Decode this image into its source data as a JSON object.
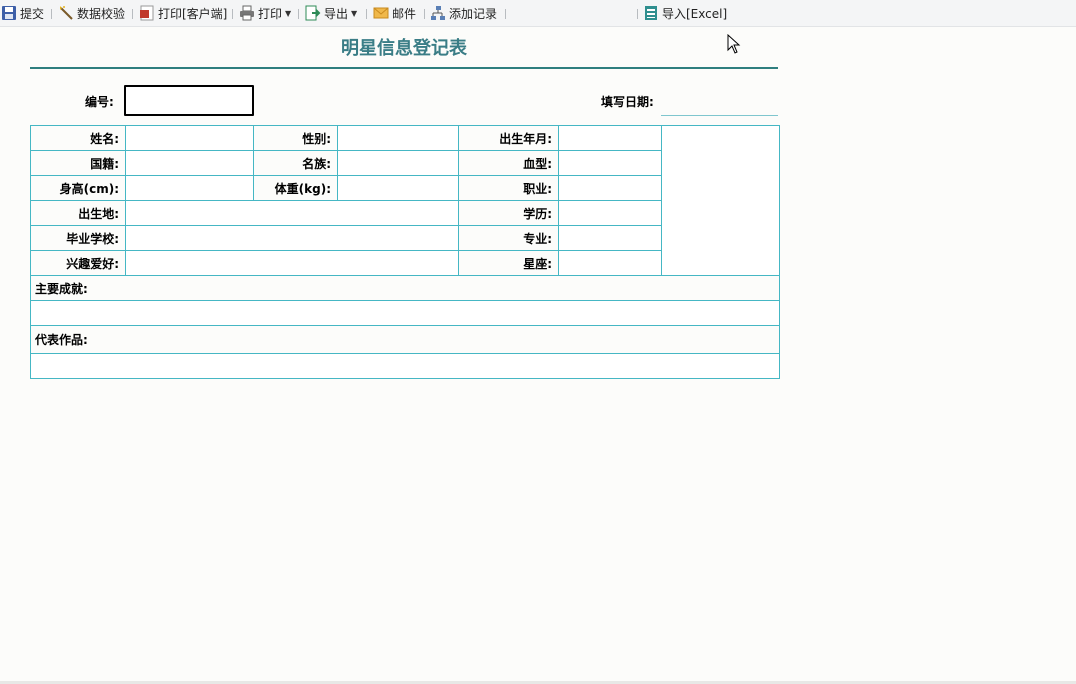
{
  "toolbar": {
    "items": [
      {
        "label": "提交",
        "icon": "save-icon"
      },
      {
        "label": "数据校验",
        "icon": "validate-wand-icon"
      },
      {
        "label": "打印[客户端]",
        "icon": "pdf-print-icon"
      },
      {
        "label": "打印",
        "icon": "printer-icon"
      },
      {
        "label": "导出",
        "icon": "export-icon"
      },
      {
        "label": "邮件",
        "icon": "mail-icon"
      },
      {
        "label": "添加记录",
        "icon": "add-record-icon"
      },
      {
        "label": "导入[Excel]",
        "icon": "excel-import-icon"
      }
    ]
  },
  "form": {
    "title": "明星信息登记表",
    "id_label": "编号:",
    "date_label": "填写日期:",
    "labels": {
      "name": "姓名:",
      "gender": "性别:",
      "birth_month": "出生年月:",
      "nationality": "国籍:",
      "ethnicity": "名族:",
      "blood_type": "血型:",
      "height": "身高(cm):",
      "weight": "体重(kg):",
      "occupation": "职业:",
      "birthplace": "出生地:",
      "education": "学历:",
      "school": "毕业学校:",
      "major": "专业:",
      "hobbies": "兴趣爱好:",
      "zodiac": "星座:",
      "achievements": "主要成就:",
      "works": "代表作品:"
    }
  },
  "colors": {
    "title": "#3a7d86",
    "grid": "#45b7c4",
    "rule": "#2f7f7f"
  }
}
